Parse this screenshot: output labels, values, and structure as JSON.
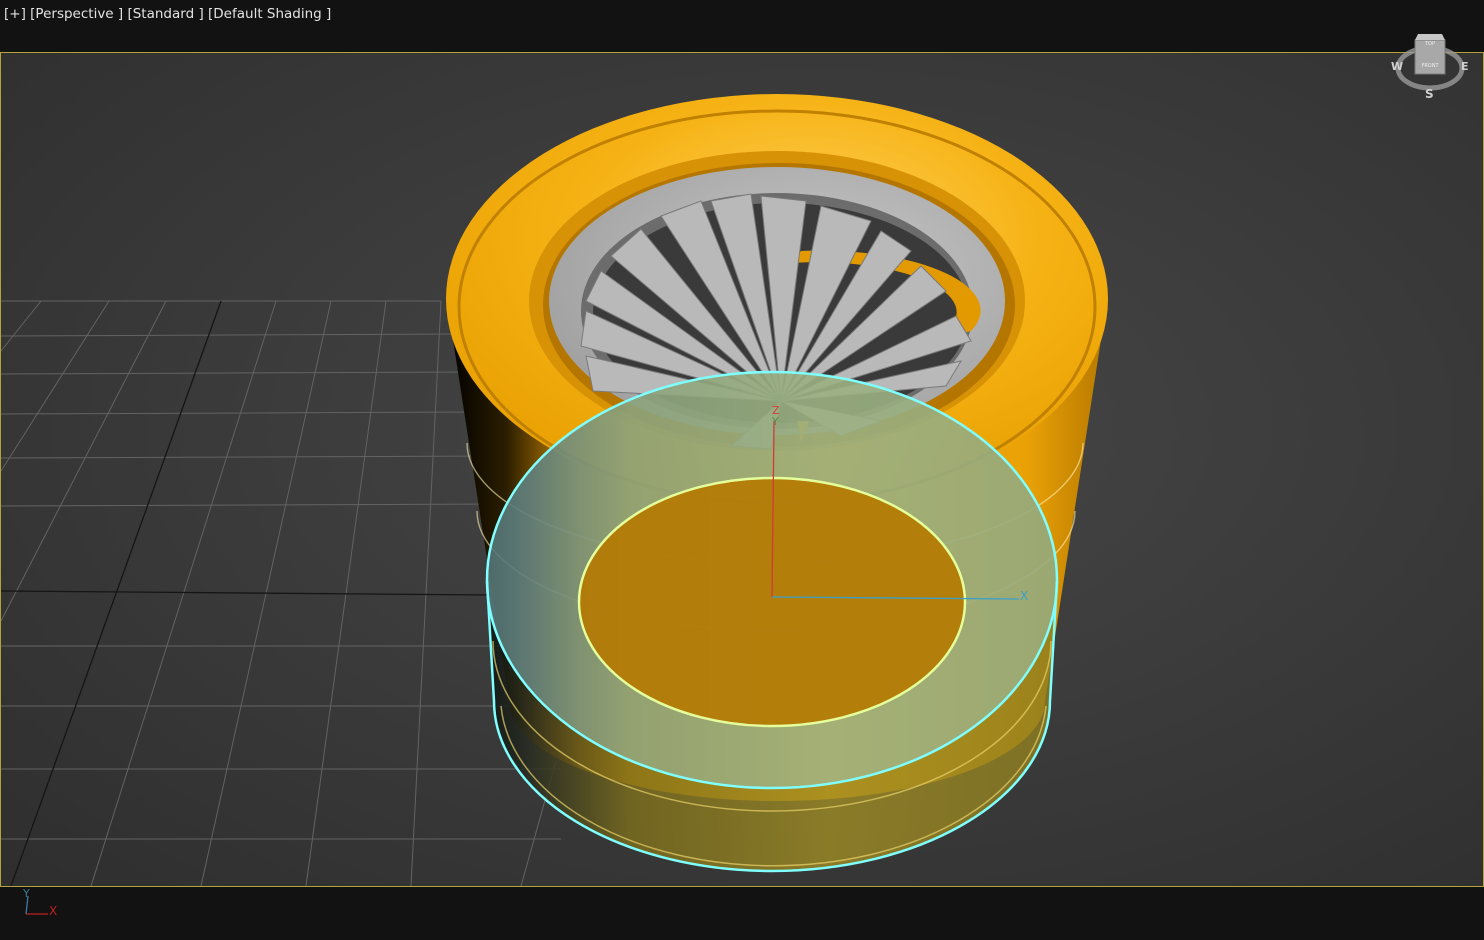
{
  "viewport": {
    "menu_plus": "[+]",
    "menu_view": "[Perspective ]",
    "menu_preset": "[Standard ]",
    "menu_shading": "[Default Shading ]"
  },
  "gizmo": {
    "axis_x": "X",
    "axis_y": "Y",
    "axis_z": "Z"
  },
  "viewcube": {
    "face_top": "TOP",
    "face_front": "FRONT",
    "compass_w": "W",
    "compass_e": "E",
    "compass_s": "S"
  },
  "tripod": {
    "axis_x": "X",
    "axis_y": "Y"
  },
  "colors": {
    "frame_border": "#b4a23a",
    "object_orange": "#f3ac08",
    "selection_cyan": "#7fffff",
    "rim_gray": "#a9a9a9"
  }
}
